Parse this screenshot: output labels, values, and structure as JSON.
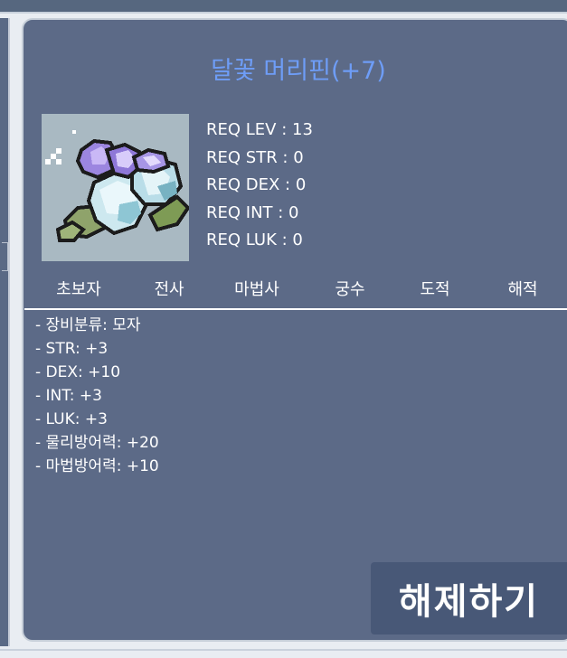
{
  "item": {
    "name": "달꽃 머리핀(+7)",
    "icon": "moonflower-hairpin-icon"
  },
  "requirements": [
    "REQ LEV : 13",
    "REQ STR : 0",
    "REQ DEX : 0",
    "REQ INT : 0",
    "REQ LUK : 0"
  ],
  "classes": [
    "초보자",
    "전사",
    "마법사",
    "궁수",
    "도적",
    "해적"
  ],
  "stats": [
    "- 장비분류: 모자",
    "- STR: +3",
    "- DEX: +10",
    "- INT: +3",
    "- LUK: +3",
    "- 물리방어력: +20",
    "- 마법방어력: +10"
  ],
  "unequip_label": "해제하기",
  "colors": {
    "title": "#6e9df7",
    "panel": "#5c6a87",
    "button": "#485877"
  }
}
